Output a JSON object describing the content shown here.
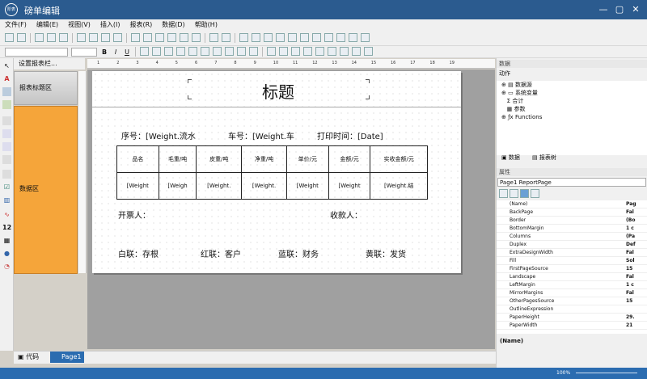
{
  "app": {
    "logo_text": "阶表",
    "title": "磅单编辑"
  },
  "window": {
    "minimize": "—",
    "maximize": "▢",
    "close": "✕"
  },
  "menu": [
    "文件(F)",
    "编辑(E)",
    "视图(V)",
    "插入(I)",
    "报表(R)",
    "数据(D)",
    "帮助(H)"
  ],
  "toolbar": {
    "bold": "B",
    "italic": "I",
    "underline": "U"
  },
  "band_header": {
    "label": "设置报表栏..."
  },
  "bands": {
    "title": "报表标题区",
    "data": "数据区"
  },
  "ruler_marks": [
    "1",
    "2",
    "3",
    "4",
    "5",
    "6",
    "7",
    "8",
    "9",
    "10",
    "11",
    "12",
    "13",
    "14",
    "15",
    "16",
    "17",
    "18",
    "19"
  ],
  "report": {
    "title": "标题",
    "serial": "序号：[Weight.流水",
    "truck": "车号：[Weight.车",
    "print_time": "打印时间：[Date]",
    "table_headers": [
      "品名",
      "毛重/吨",
      "皮重/吨",
      "净重/吨",
      "单价/元",
      "金额/元",
      "实收金额/元"
    ],
    "table_values": [
      "[Weight",
      "[Weigh",
      "[Weight.",
      "[Weight.",
      "[Weight",
      "[Weight",
      "[Weight.结"
    ],
    "drawer": "开票人：",
    "payee": "收款人：",
    "copies": [
      "白联：存根",
      "红联：客户",
      "蓝联：财务",
      "黄联：发货"
    ]
  },
  "tabs": {
    "code": "代码",
    "page": "Page1"
  },
  "status": {
    "zoom": "100%"
  },
  "data_panel": {
    "title": "数据",
    "action": "动作",
    "tree": [
      "数据源",
      "系统变量",
      "合计",
      "参数",
      "Functions"
    ],
    "tab_data": "数据",
    "tab_tree": "报表树"
  },
  "props_panel": {
    "title": "属性",
    "selector": "Page1 ReportPage",
    "rows": [
      {
        "name": "(Name)",
        "value": "Pag"
      },
      {
        "name": "BackPage",
        "value": "Fal"
      },
      {
        "name": "Border",
        "value": "(Bo"
      },
      {
        "name": "BottomMargin",
        "value": "1 c"
      },
      {
        "name": "Columns",
        "value": "(Pa"
      },
      {
        "name": "Duplex",
        "value": "Def"
      },
      {
        "name": "ExtraDesignWidth",
        "value": "Fal"
      },
      {
        "name": "Fill",
        "value": "Sol"
      },
      {
        "name": "FirstPageSource",
        "value": "15"
      },
      {
        "name": "Landscape",
        "value": "Fal"
      },
      {
        "name": "LeftMargin",
        "value": "1 c"
      },
      {
        "name": "MirrorMargins",
        "value": "Fal"
      },
      {
        "name": "OtherPagesSource",
        "value": "15"
      },
      {
        "name": "OutlineExpression",
        "value": ""
      },
      {
        "name": "PaperHeight",
        "value": "29."
      },
      {
        "name": "PaperWidth",
        "value": "21"
      }
    ],
    "footer": "(Name)"
  }
}
